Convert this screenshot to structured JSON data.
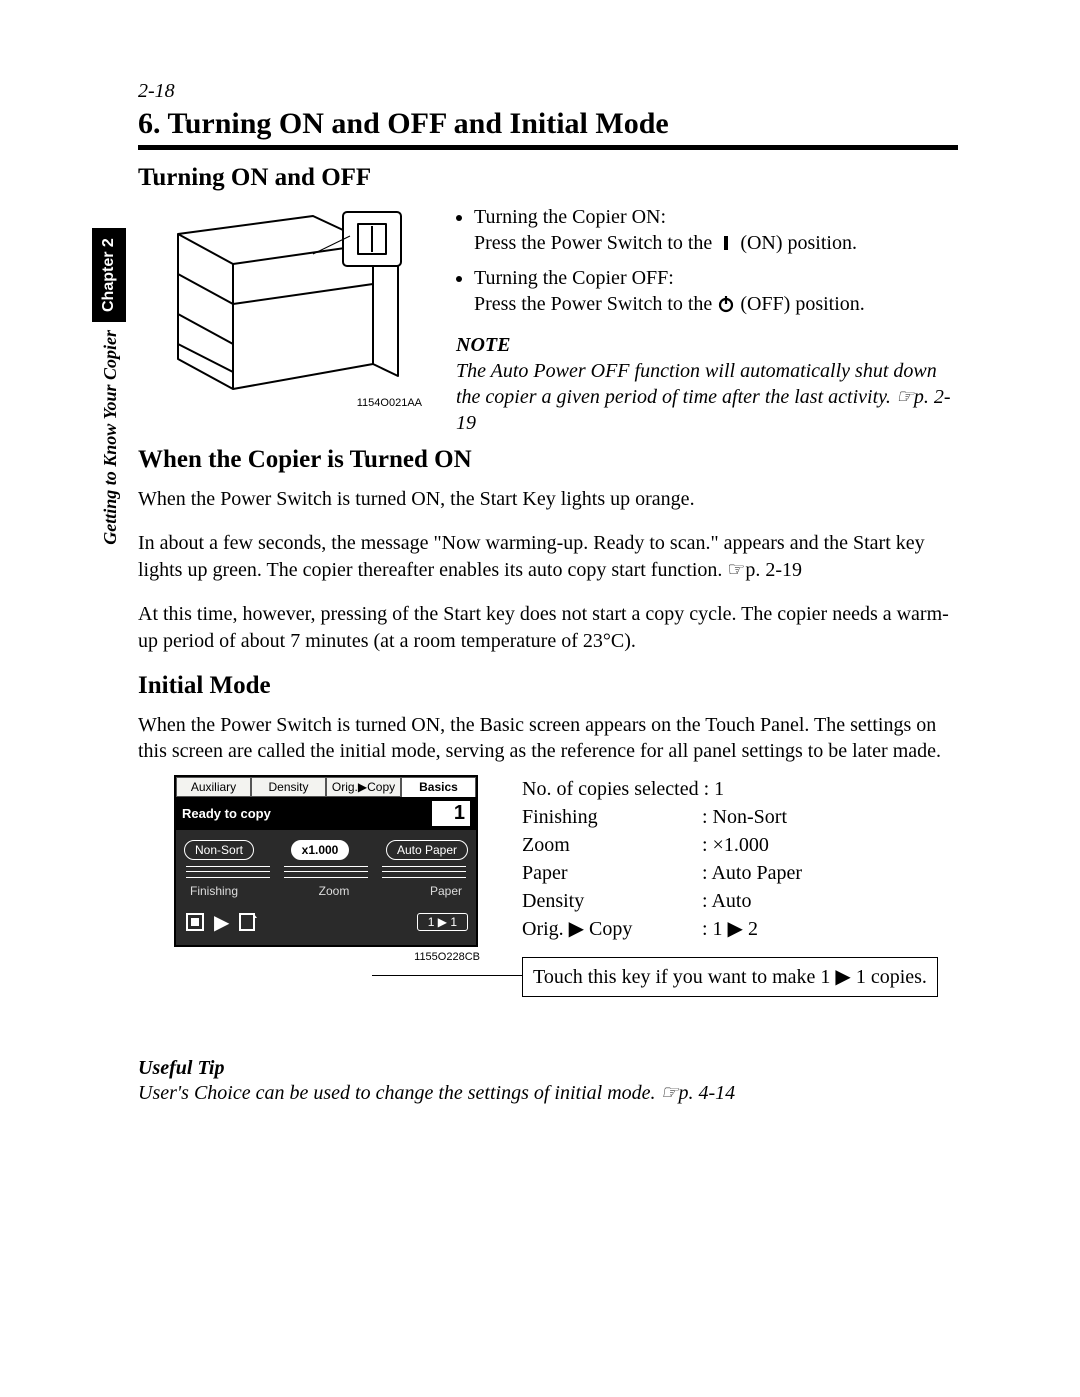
{
  "pageNumber": "2-18",
  "title": "6. Turning ON and OFF and Initial Mode",
  "sideTab": "Chapter 2",
  "sideText": "Getting to Know Your Copier",
  "section1": {
    "heading": "Turning ON and OFF",
    "illustrationId": "1154O021AA",
    "bullets": {
      "onTitle": "Turning the Copier ON:",
      "onLinePre": "Press the Power Switch to the ",
      "onLinePost": " (ON) position.",
      "offTitle": "Turning the Copier OFF:",
      "offLinePre": "Press the Power Switch to the ",
      "offLinePost": " (OFF) position."
    },
    "noteHead": "NOTE",
    "noteBody": "The Auto Power OFF function will automatically shut down the copier a given period of time after the last activity. ☞p. 2-19"
  },
  "section2": {
    "heading": "When the Copier is Turned ON",
    "para1": "When the Power Switch is turned ON, the Start Key lights up orange.",
    "para2": "In about a few seconds, the message \"Now warming-up. Ready to scan.\" appears and the Start key lights up green. The copier thereafter enables its auto copy start function. ☞p. 2-19",
    "para3": "At this time, however, pressing of the Start key does not start a copy cycle. The copier needs a warm-up period of about 7 minutes (at a room temperature of 23°C)."
  },
  "section3": {
    "heading": "Initial Mode",
    "para": "When the Power Switch is turned ON, the Basic screen appears on the Touch Panel. The settings on this screen are called the initial mode, serving as the reference for all panel settings to be later made.",
    "panel": {
      "tabs": [
        "Auxiliary",
        "Density",
        "Orig.▶Copy",
        "Basics"
      ],
      "status": "Ready to copy",
      "count": "1",
      "mid": {
        "nonSort": "Non-Sort",
        "zoom": "x1.000",
        "autoPaper": "Auto Paper"
      },
      "labels": [
        "Finishing",
        "Zoom",
        "Paper"
      ],
      "oneToOne": "1 ▶ 1",
      "imageId": "1155O228CB"
    },
    "settings": {
      "copiesLine": "No. of copies selected : 1",
      "rows": [
        {
          "label": "Finishing",
          "value": ": Non-Sort"
        },
        {
          "label": "Zoom",
          "value": ": ×1.000"
        },
        {
          "label": "Paper",
          "value": ": Auto Paper"
        },
        {
          "label": "Density",
          "value": ": Auto"
        },
        {
          "label": "Orig. ▶ Copy",
          "value": ": 1 ▶ 2"
        }
      ]
    },
    "callout": "Touch this key if you want to make 1 ▶ 1 copies."
  },
  "tip": {
    "head": "Useful Tip",
    "body": "User's Choice can be used to change the settings of initial mode. ☞p. 4-14"
  }
}
